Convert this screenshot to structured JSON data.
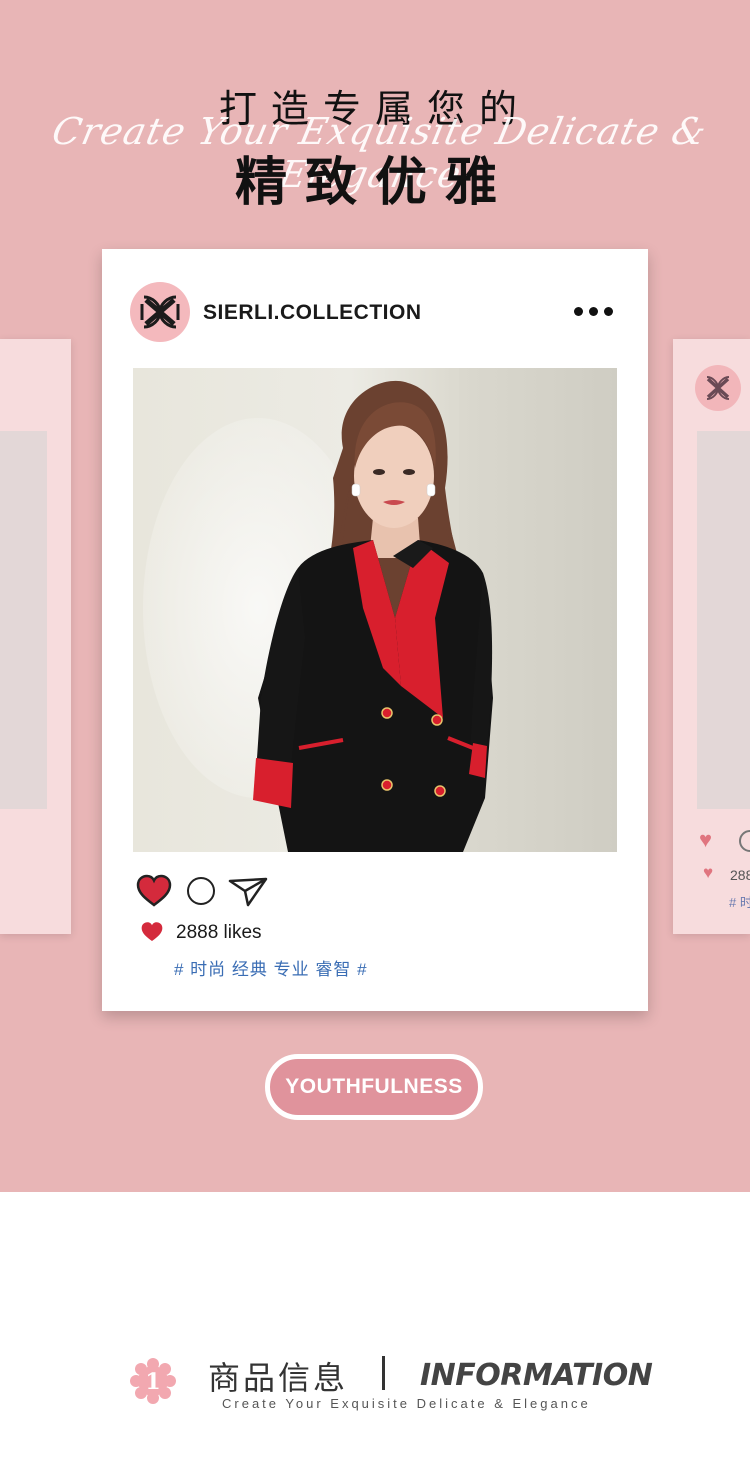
{
  "header": {
    "title_line1": "打造专属您的",
    "script_tagline": "Create Your Exquisite Delicate & Elegance",
    "title_line2": "精致优雅"
  },
  "post": {
    "account_name": "SIERLI.COLLECTION",
    "avatar_icon": "sierli-logo-icon",
    "more_icon": "more-dots-icon",
    "photo": "woman-in-black-blazer-dress-with-red-lapels",
    "actions": [
      "heart-icon",
      "comment-icon",
      "send-icon"
    ],
    "likes_label": "2888 likes",
    "hashtags": "# 时尚 经典 专业 睿智 #"
  },
  "side_card_right": {
    "likes_label": "288",
    "hashtags": "# 时"
  },
  "cta": {
    "label": "YOUTHFULNESS"
  },
  "info_section": {
    "number": "1",
    "title_cn": "商品信息",
    "title_en": "INFORMATION",
    "subtitle": "Create Your Exquisite Delicate & Elegance"
  },
  "colors": {
    "background_pink": "#e8b5b6",
    "heart_red": "#d42a3c",
    "hashtag_blue": "#3a6db4",
    "pill_fill": "#e0939c",
    "badge_pink": "#f2a8b0"
  }
}
